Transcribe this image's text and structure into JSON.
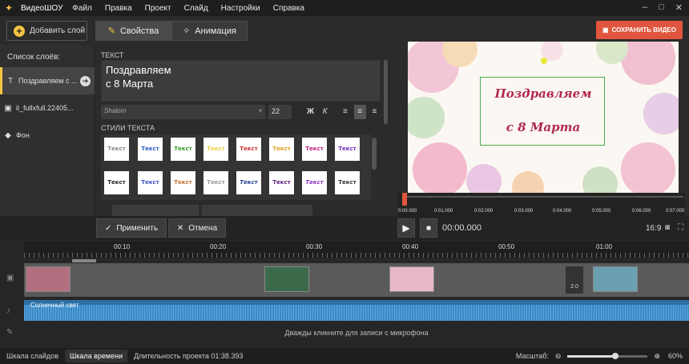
{
  "app": {
    "name": "ВидеоШОУ"
  },
  "menu": [
    "Файл",
    "Правка",
    "Проект",
    "Слайд",
    "Настройки",
    "Справка"
  ],
  "toolbar": {
    "add_layer": "Добавить слой",
    "tab_properties": "Свойства",
    "tab_animation": "Анимация"
  },
  "layers": {
    "title": "Список слоёв:",
    "items": [
      {
        "label": "Поздравляем с ...",
        "icon": "text-icon"
      },
      {
        "label": "il_fullxfull.22405...",
        "icon": "image-icon"
      },
      {
        "label": "Фон",
        "icon": "fill-icon"
      }
    ]
  },
  "props": {
    "text_label": "ТЕКСТ",
    "text_value": "Поздравляем\nс 8 Марта",
    "font_size": "22",
    "styles_label": "СТИЛИ ТЕКСТА",
    "style_sample": "Текст"
  },
  "preview": {
    "save_label": "СОХРАНИТЬ ВИДЕО",
    "canvas_text_1": "Поздравляем",
    "canvas_text_2": "с 8 Марта",
    "ruler_labels": [
      "0:00.000",
      "0:01.000",
      "0:02.000",
      "0:03.000",
      "0:04.000",
      "0:05.000",
      "0:06.000",
      "0:07.000"
    ],
    "time": "00:00.000",
    "aspect": "16:9"
  },
  "controls": {
    "apply": "Применить",
    "cancel": "Отмена"
  },
  "timeline": {
    "ticks": [
      "00:10",
      "00:20",
      "00:30",
      "00:40",
      "00:50",
      "01:00"
    ],
    "transition_value": "2.0",
    "audio_title": "Солнечный свет",
    "mic_hint": "Дважды кликните для записи с микрофона"
  },
  "status": {
    "slides": "Шкала слайдов",
    "timeline": "Шкала времени",
    "duration": "Длительность проекта 01:38.393",
    "zoom_label": "Масштаб:",
    "zoom_value": "60%",
    "zoom_level_percent": 60
  },
  "colors": {
    "accent": "#f4c542",
    "save": "#e0553d",
    "audio": "#2c6fa3",
    "canvas_text": "#b02a4f"
  }
}
